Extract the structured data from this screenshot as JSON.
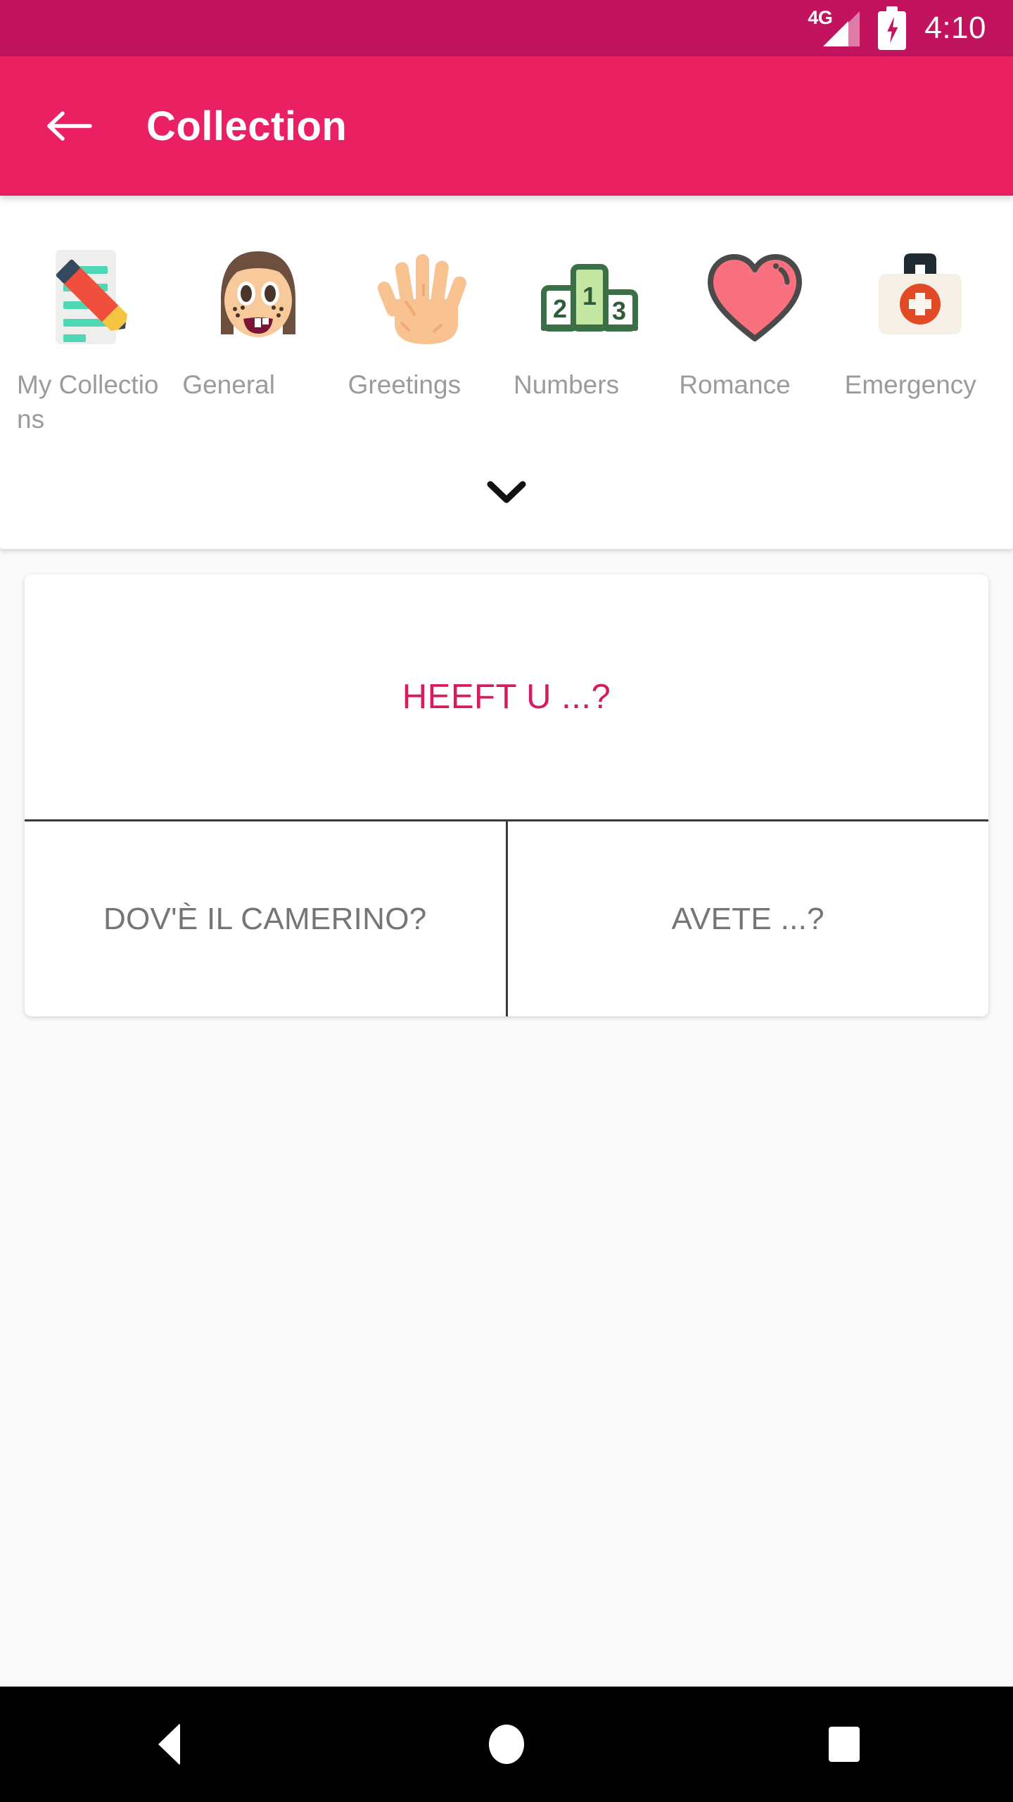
{
  "status_bar": {
    "network_label": "4G",
    "time": "4:10",
    "signal_icon": "signal-bars-icon",
    "battery_icon": "battery-charging-icon",
    "background_color": "#c2135f"
  },
  "app_bar": {
    "title": "Collection",
    "back_icon": "back-arrow-icon",
    "background_color": "#ea2062",
    "title_color": "#ffffff"
  },
  "categories": {
    "expand_icon": "chevron-down-icon",
    "label_color": "#9b9b9b",
    "items": [
      {
        "label": "My Collections",
        "icon": "memo-pencil-icon"
      },
      {
        "label": "General",
        "icon": "girl-face-icon"
      },
      {
        "label": "Greetings",
        "icon": "raised-hand-icon"
      },
      {
        "label": "Numbers",
        "icon": "podium-123-icon"
      },
      {
        "label": "Romance",
        "icon": "heart-icon"
      },
      {
        "label": "Emergency",
        "icon": "first-aid-kit-icon"
      }
    ]
  },
  "phrase_card": {
    "primary_phrase": "HEEFT U ...?",
    "primary_color": "#d81b60",
    "option_color": "#757575",
    "options": [
      {
        "text": "DOV'È IL CAMERINO?"
      },
      {
        "text": "AVETE ...?"
      }
    ]
  },
  "nav_bar": {
    "background_color": "#000000",
    "buttons": [
      {
        "name": "back",
        "icon": "triangle-back-icon"
      },
      {
        "name": "home",
        "icon": "circle-home-icon"
      },
      {
        "name": "recents",
        "icon": "square-recents-icon"
      }
    ]
  }
}
